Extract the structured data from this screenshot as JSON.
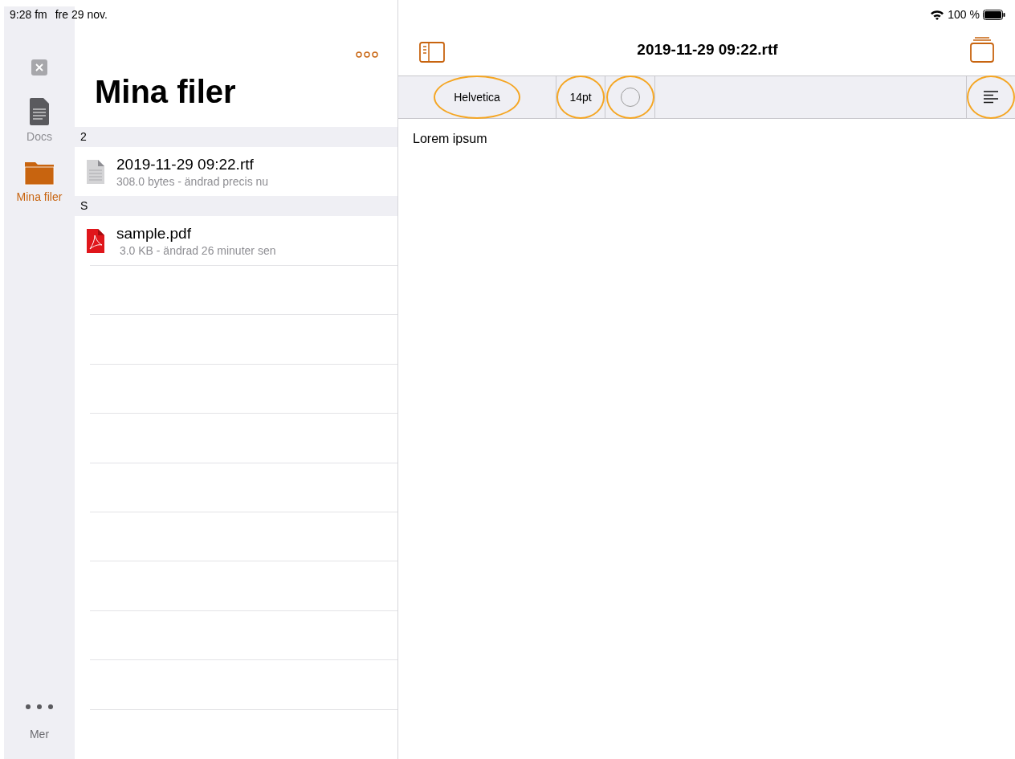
{
  "status_bar": {
    "time": "9:28 fm",
    "date": "fre 29 nov.",
    "battery": "100 %"
  },
  "sidebar": {
    "items": [
      {
        "kind": "close"
      },
      {
        "kind": "docs",
        "label": "Docs",
        "selected": false
      },
      {
        "kind": "folder",
        "label": "Mina filer",
        "selected": true
      }
    ],
    "more": {
      "label": "Mer"
    }
  },
  "file_list": {
    "title": "Mina filer",
    "sections": [
      {
        "header": "2",
        "files": [
          {
            "kind": "rtf",
            "name": "2019-11-29 09:22.rtf",
            "details": "308.0 bytes - ändrad precis nu"
          }
        ]
      },
      {
        "header": "S",
        "files": [
          {
            "kind": "pdf",
            "name": "sample.pdf",
            "details": " 3.0 KB - ändrad 26 minuter sen"
          }
        ]
      }
    ]
  },
  "editor": {
    "title": "2019-11-29 09:22.rtf",
    "toolbar": [
      {
        "kind": "font",
        "label": "Helvetica",
        "circled": true
      },
      {
        "kind": "size",
        "label": "14pt",
        "circled": true
      },
      {
        "kind": "color",
        "circled": true
      },
      {
        "kind": "align",
        "circled": true
      }
    ],
    "body": "Lorem ipsum"
  }
}
